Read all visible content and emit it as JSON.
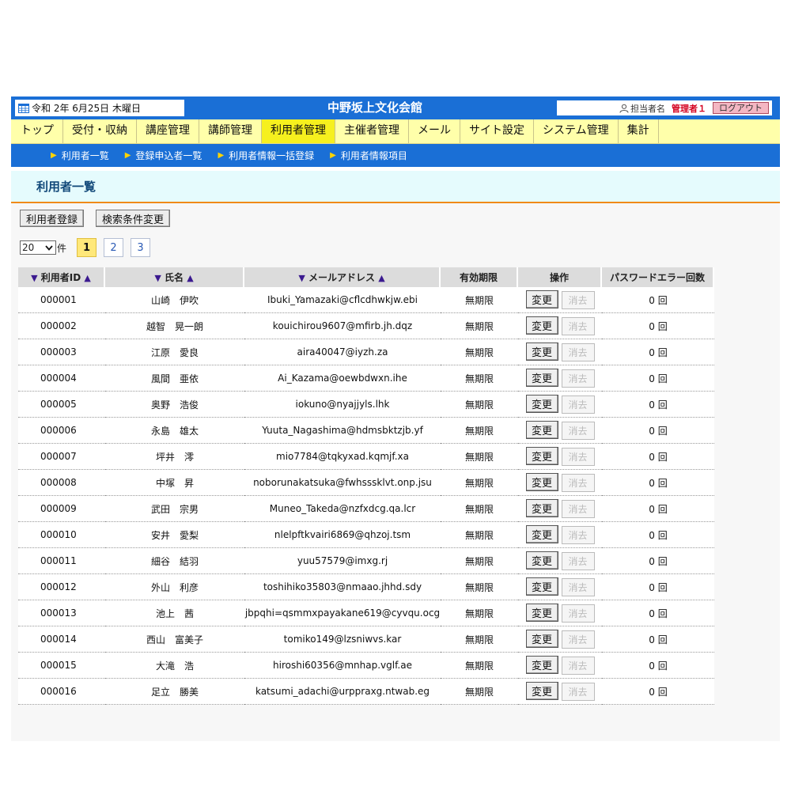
{
  "header": {
    "date": "令和 2年 6月25日 木曜日",
    "site_title": "中野坂上文化会館",
    "user_label": "担当者名",
    "user_name": "管理者１",
    "logout_label": "ログアウト"
  },
  "main_nav": [
    {
      "label": "トップ",
      "active": false
    },
    {
      "label": "受付・収納",
      "active": false
    },
    {
      "label": "講座管理",
      "active": false
    },
    {
      "label": "講師管理",
      "active": false
    },
    {
      "label": "利用者管理",
      "active": true
    },
    {
      "label": "主催者管理",
      "active": false
    },
    {
      "label": "メール",
      "active": false
    },
    {
      "label": "サイト設定",
      "active": false
    },
    {
      "label": "システム管理",
      "active": false
    },
    {
      "label": "集計",
      "active": false
    }
  ],
  "sub_nav": [
    "利用者一覧",
    "登録申込者一覧",
    "利用者情報一括登録",
    "利用者情報項目"
  ],
  "page_title": "利用者一覧",
  "actions": {
    "register": "利用者登録",
    "search_change": "検索条件変更"
  },
  "pager": {
    "per_page": "20",
    "per_page_unit": "件",
    "pages": [
      "1",
      "2",
      "3"
    ],
    "current": "1"
  },
  "table": {
    "headers": {
      "id": "利用者ID",
      "name": "氏名",
      "email": "メールアドレス",
      "expiry": "有効期限",
      "ops": "操作",
      "pw_errors": "パスワードエラー回数"
    },
    "edit_label": "変更",
    "delete_label": "消去",
    "rows": [
      {
        "id": "000001",
        "name": "山崎　伊吹",
        "email": "Ibuki_Yamazaki@cflcdhwkjw.ebi",
        "expiry": "無期限",
        "pw": "0 回"
      },
      {
        "id": "000002",
        "name": "越智　晃一朗",
        "email": "kouichirou9607@mfirb.jh.dqz",
        "expiry": "無期限",
        "pw": "0 回"
      },
      {
        "id": "000003",
        "name": "江原　愛良",
        "email": "aira40047@iyzh.za",
        "expiry": "無期限",
        "pw": "0 回"
      },
      {
        "id": "000004",
        "name": "風間　亜依",
        "email": "Ai_Kazama@oewbdwxn.ihe",
        "expiry": "無期限",
        "pw": "0 回"
      },
      {
        "id": "000005",
        "name": "奥野　浩俊",
        "email": "iokuno@nyajjyls.lhk",
        "expiry": "無期限",
        "pw": "0 回"
      },
      {
        "id": "000006",
        "name": "永島　雄太",
        "email": "Yuuta_Nagashima@hdmsbktzjb.yf",
        "expiry": "無期限",
        "pw": "0 回"
      },
      {
        "id": "000007",
        "name": "坪井　澪",
        "email": "mio7784@tqkyxad.kqmjf.xa",
        "expiry": "無期限",
        "pw": "0 回"
      },
      {
        "id": "000008",
        "name": "中塚　昇",
        "email": "noborunakatsuka@fwhsssklvt.onp.jsu",
        "expiry": "無期限",
        "pw": "0 回"
      },
      {
        "id": "000009",
        "name": "武田　宗男",
        "email": "Muneo_Takeda@nzfxdcg.qa.lcr",
        "expiry": "無期限",
        "pw": "0 回"
      },
      {
        "id": "000010",
        "name": "安井　愛梨",
        "email": "nlelpftkvairi6869@qhzoj.tsm",
        "expiry": "無期限",
        "pw": "0 回"
      },
      {
        "id": "000011",
        "name": "細谷　結羽",
        "email": "yuu57579@imxg.rj",
        "expiry": "無期限",
        "pw": "0 回"
      },
      {
        "id": "000012",
        "name": "外山　利彦",
        "email": "toshihiko35803@nmaao.jhhd.sdy",
        "expiry": "無期限",
        "pw": "0 回"
      },
      {
        "id": "000013",
        "name": "池上　茜",
        "email": "jbpqhi=qsmmxpayakane619@cyvqu.ocg",
        "expiry": "無期限",
        "pw": "0 回"
      },
      {
        "id": "000014",
        "name": "西山　富美子",
        "email": "tomiko149@lzsniwvs.kar",
        "expiry": "無期限",
        "pw": "0 回"
      },
      {
        "id": "000015",
        "name": "大滝　浩",
        "email": "hiroshi60356@mnhap.vglf.ae",
        "expiry": "無期限",
        "pw": "0 回"
      },
      {
        "id": "000016",
        "name": "足立　勝美",
        "email": "katsumi_adachi@urppraxg.ntwab.eg",
        "expiry": "無期限",
        "pw": "0 回"
      }
    ]
  }
}
